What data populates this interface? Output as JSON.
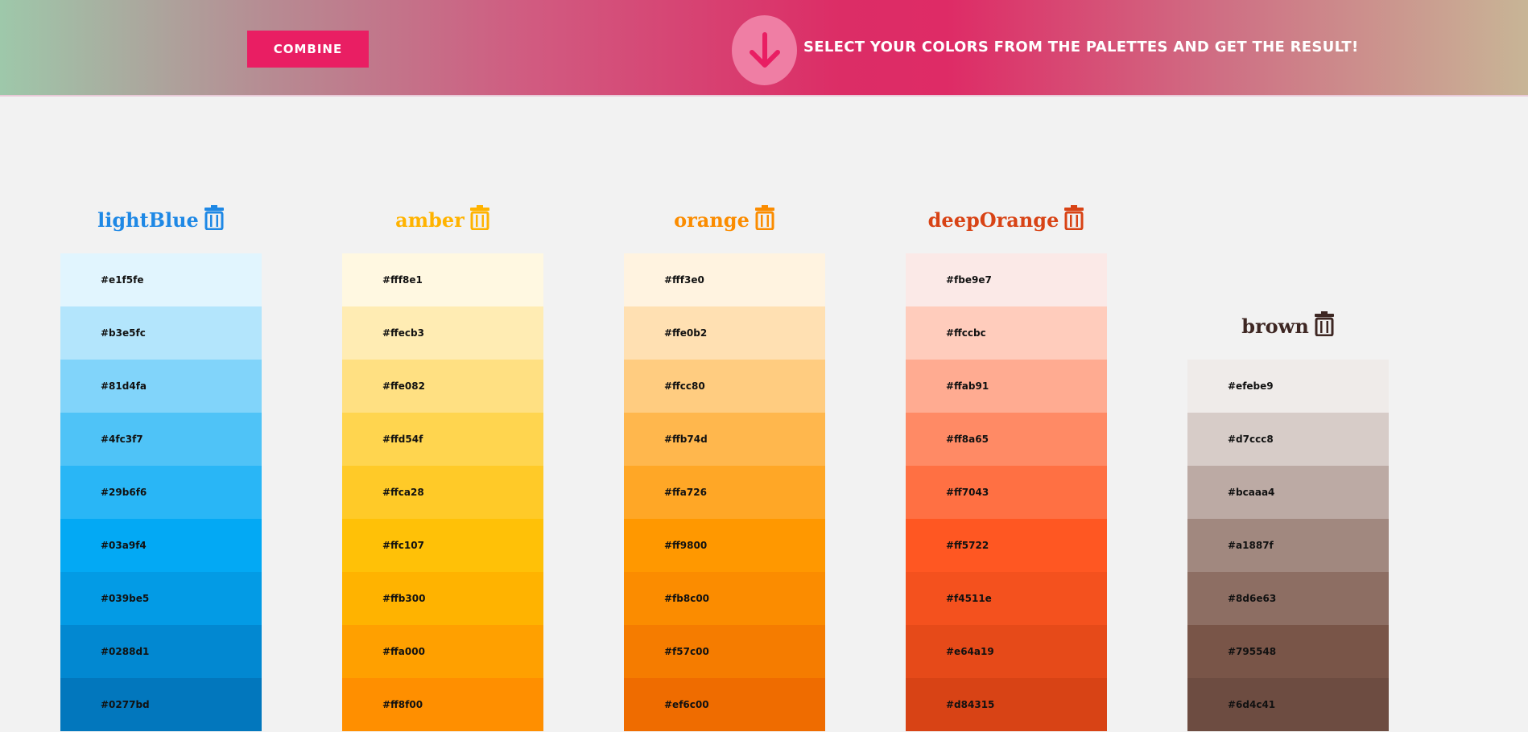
{
  "header": {
    "combine_label": "COMBINE",
    "message": "SELECT YOUR COLORS FROM THE PALETTES AND GET THE RESULT!",
    "arrow_icon": "arrow-down-icon"
  },
  "palettes": [
    {
      "name": "lightBlue",
      "title_color": "#1e88e5",
      "colors": [
        "#e1f5fe",
        "#b3e5fc",
        "#81d4fa",
        "#4fc3f7",
        "#29b6f6",
        "#03a9f4",
        "#039be5",
        "#0288d1",
        "#0277bd"
      ]
    },
    {
      "name": "amber",
      "title_color": "#ffb300",
      "colors": [
        "#fff8e1",
        "#ffecb3",
        "#ffe082",
        "#ffd54f",
        "#ffca28",
        "#ffc107",
        "#ffb300",
        "#ffa000",
        "#ff8f00"
      ]
    },
    {
      "name": "orange",
      "title_color": "#fb8c00",
      "colors": [
        "#fff3e0",
        "#ffe0b2",
        "#ffcc80",
        "#ffb74d",
        "#ffa726",
        "#ff9800",
        "#fb8c00",
        "#f57c00",
        "#ef6c00"
      ]
    },
    {
      "name": "deepOrange",
      "title_color": "#d84315",
      "colors": [
        "#fbe9e7",
        "#ffccbc",
        "#ffab91",
        "#ff8a65",
        "#ff7043",
        "#ff5722",
        "#f4511e",
        "#e64a19",
        "#d84315"
      ]
    },
    {
      "name": "brown",
      "title_color": "#3e2723",
      "colors": [
        "#efebe9",
        "#d7ccc8",
        "#bcaaa4",
        "#a1887f",
        "#8d6e63",
        "#795548",
        "#6d4c41"
      ]
    }
  ]
}
